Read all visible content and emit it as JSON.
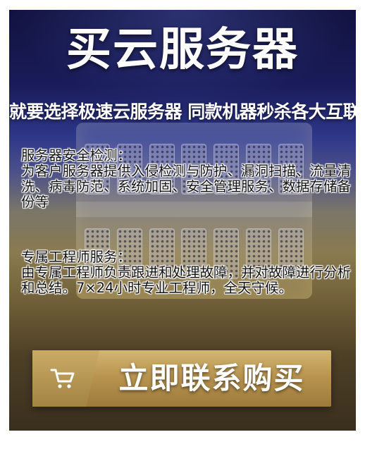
{
  "poster": {
    "title": "买云服务器",
    "subtitle": "就要选择极速云服务器 同款机器秒杀各大互联",
    "section1": {
      "heading": "服务器安全检测：",
      "body": "为客户服务器提供入侵检测与防护、漏洞扫描、流量清洗、病毒防范、系统加固、安全管理服务、数据存储备份等"
    },
    "section2": {
      "heading": "专属工程师服务：",
      "body": "由专属工程师负责跟进和处理故障，并对故障进行分析和总结。7×24小时专业工程师，全天守候。"
    },
    "cta": {
      "icon": "shopping-cart-icon",
      "label": "立即联系购买"
    }
  },
  "colors": {
    "top_bg": "#1a1c5a",
    "bottom_bg": "#6e5d36",
    "button_gold": "#b99550",
    "title_text": "#ffffff",
    "body_text": "#111111"
  }
}
